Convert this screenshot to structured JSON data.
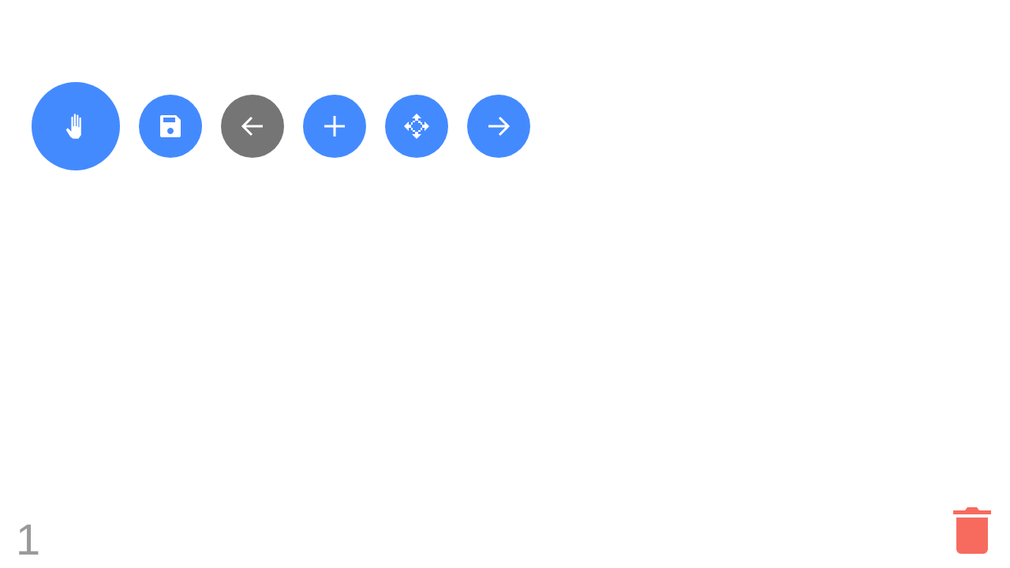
{
  "hand_button": {
    "selected": true
  },
  "toolbar": [
    {
      "kind": "save",
      "disabled": false
    },
    {
      "kind": "back",
      "disabled": true
    },
    {
      "kind": "add",
      "disabled": false
    },
    {
      "kind": "move",
      "disabled": false
    },
    {
      "kind": "forward",
      "disabled": false
    }
  ],
  "page_number": "1"
}
